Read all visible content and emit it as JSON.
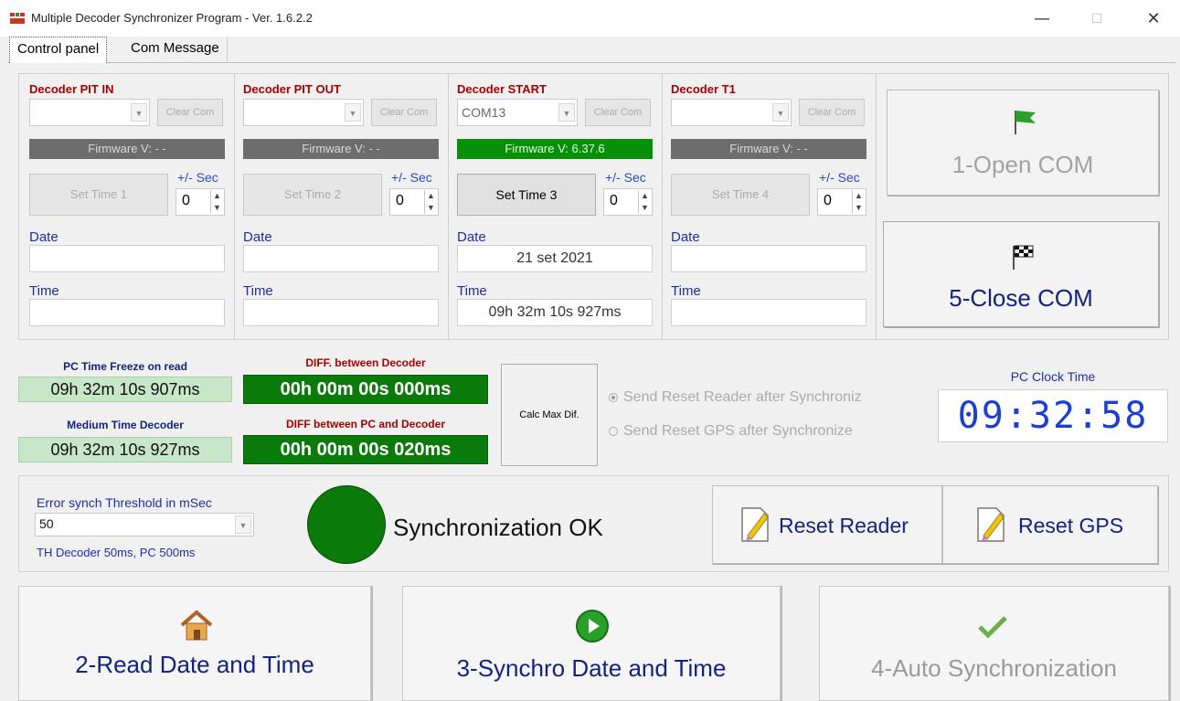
{
  "window": {
    "title": "Multiple Decoder Synchronizer Program - Ver. 1.6.2.2",
    "minimize": "—",
    "maximize": "☐",
    "close": "✕"
  },
  "tabs": [
    {
      "label": "Control panel",
      "active": true
    },
    {
      "label": "Com Message",
      "active": false
    }
  ],
  "decoders": [
    {
      "title": "Decoder PIT IN",
      "com": "",
      "clear": "Clear Com",
      "firmware": "Firmware V: - -",
      "firmware_ok": false,
      "set_time": "Set Time 1",
      "set_enabled": false,
      "plusminus": "+/- Sec",
      "sec": "0",
      "date_label": "Date",
      "date": "",
      "time_label": "Time",
      "time": ""
    },
    {
      "title": "Decoder PIT OUT",
      "com": "",
      "clear": "Clear Com",
      "firmware": "Firmware V: - -",
      "firmware_ok": false,
      "set_time": "Set Time 2",
      "set_enabled": false,
      "plusminus": "+/- Sec",
      "sec": "0",
      "date_label": "Date",
      "date": "",
      "time_label": "Time",
      "time": ""
    },
    {
      "title": "Decoder START",
      "com": "COM13",
      "clear": "Clear Com",
      "firmware": "Firmware V: 6.37.6",
      "firmware_ok": true,
      "set_time": "Set Time 3",
      "set_enabled": true,
      "plusminus": "+/- Sec",
      "sec": "0",
      "date_label": "Date",
      "date": "21 set 2021",
      "time_label": "Time",
      "time": "09h 32m 10s 927ms"
    },
    {
      "title": "Decoder T1",
      "com": "",
      "clear": "Clear Com",
      "firmware": "Firmware V: - -",
      "firmware_ok": false,
      "set_time": "Set Time 4",
      "set_enabled": false,
      "plusminus": "+/- Sec",
      "sec": "0",
      "date_label": "Date",
      "date": "",
      "time_label": "Time",
      "time": ""
    }
  ],
  "com_buttons": {
    "open": "1-Open COM",
    "close": "5-Close COM"
  },
  "timing": {
    "pc_freeze_label": "PC Time Freeze on read",
    "pc_freeze_value": "09h 32m 10s 907ms",
    "medium_label": "Medium Time Decoder",
    "medium_value": "09h 32m 10s 927ms",
    "diff_decoder_label": "DIFF. between Decoder",
    "diff_decoder_value": "00h 00m 00s 000ms",
    "diff_pc_label": "DIFF between PC and Decoder",
    "diff_pc_value": "00h 00m 00s 020ms",
    "calc_button": "Calc Max Dif."
  },
  "options": {
    "reset_reader_option": "Send Reset Reader after Synchroniz",
    "reset_gps_option": "Send Reset GPS after Synchronize"
  },
  "clock": {
    "label": "PC Clock Time",
    "value": "09:32:58"
  },
  "sync": {
    "threshold_label": "Error synch Threshold in mSec",
    "threshold_value": "50",
    "threshold_note": "TH Decoder 50ms, PC 500ms",
    "status": "Synchronization OK",
    "indicator_color": "#0a7a0a"
  },
  "reset_buttons": {
    "reader": "Reset Reader",
    "gps": "Reset GPS"
  },
  "bottom_buttons": {
    "read": "2-Read Date and Time",
    "synchro": "3-Synchro Date and Time",
    "auto": "4-Auto Synchronization"
  }
}
